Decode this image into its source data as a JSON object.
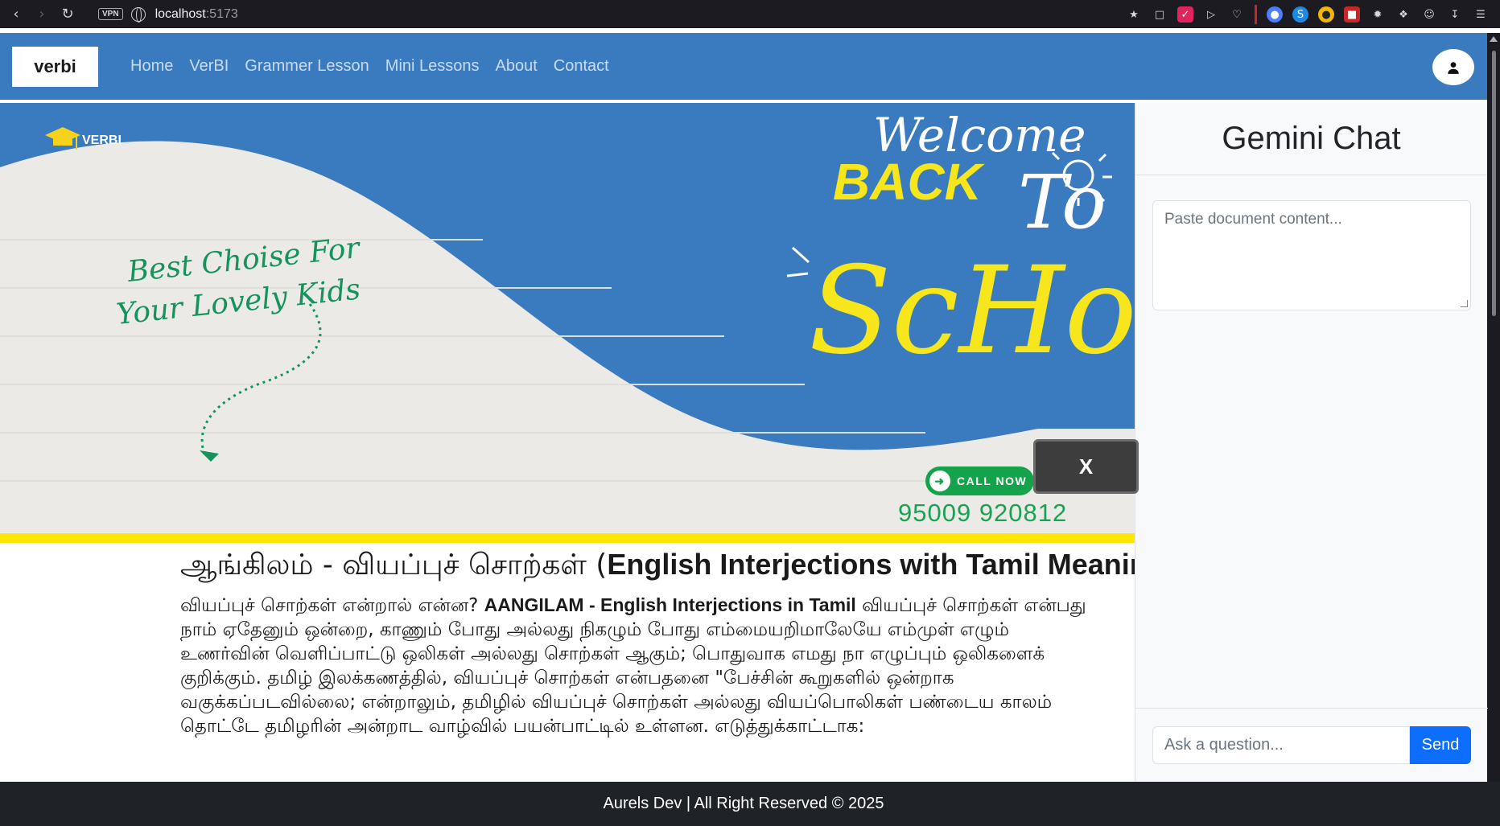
{
  "browser": {
    "url_host": "localhost",
    "url_port": ":5173",
    "vpn_label": "VPN"
  },
  "navbar": {
    "brand": "verbi",
    "links": [
      "Home",
      "VerBI",
      "Grammer Lesson",
      "Mini Lessons",
      "About",
      "Contact"
    ]
  },
  "banner": {
    "logo_text": "VERBI",
    "welcome": "Welcome",
    "back": "BACK",
    "to": "To",
    "school": "ScHool",
    "tagline_line1": "Best Choise For",
    "tagline_line2": "Your Lovely Kids",
    "call_now": "CALL NOW",
    "phone": "95009 920812",
    "close_label": "X"
  },
  "article": {
    "title_tamil": "ஆங்கிலம் - வியப்புச் சொற்கள் (",
    "title_english": "English Interjections with Tamil Meanings )",
    "p_line1_a": "வியப்புச் சொற்கள் என்றால் என்ன? ",
    "p_line1_b": "AANGILAM - English Interjections in Tamil",
    "p_line1_c": " வியப்புச் சொற்கள் என்பது",
    "p_line2": "நாம் ஏதேனும் ஒன்றை, காணும் போது அல்லது நிகழும் போது எம்மையறிமாலேயே எம்முள் எழும்",
    "p_line3": "உணர்வின் வெளிப்பாட்டு ஒலிகள் அல்லது சொற்கள் ஆகும்; பொதுவாக எமது நா எழுப்பும் ஒலிகளைக்",
    "p_line4": "குறிக்கும். தமிழ் இலக்கணத்தில், வியப்புச் சொற்கள் என்பதனை \"பேச்சின் கூறுகளில் ஒன்றாக",
    "p_line5": "வகுக்கப்படவில்லை; என்றாலும், தமிழில் வியப்புச் சொற்கள் அல்லது வியப்பொலிகள் பண்டைய காலம்",
    "p_line6": "தொட்டே தமிழரின் அன்றாட வாழ்வில் பயன்பாட்டில் உள்ளன. எடுத்துக்காட்டாக:"
  },
  "chat": {
    "title": "Gemini Chat",
    "doc_placeholder": "Paste document content...",
    "ask_placeholder": "Ask a question...",
    "send_label": "Send"
  },
  "footer": {
    "text": "Aurels Dev | All Right Reserved © 2025"
  },
  "colors": {
    "navbar": "#3a7bbf",
    "banner_wall": "#eceae6",
    "banner_yellow": "#ffe600",
    "call_green": "#14a34b",
    "send_blue": "#0d6efd",
    "footer": "#1f2226"
  }
}
